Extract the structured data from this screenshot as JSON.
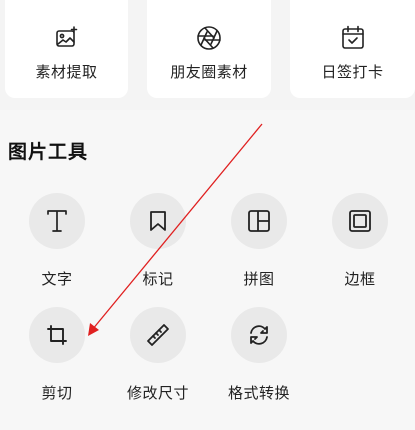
{
  "top_cards": [
    {
      "label": "素材提取",
      "icon": "image-extract-icon"
    },
    {
      "label": "朋友圈素材",
      "icon": "aperture-icon"
    },
    {
      "label": "日签打卡",
      "icon": "calendar-check-icon"
    }
  ],
  "section": {
    "title": "图片工具"
  },
  "tools": [
    {
      "label": "文字",
      "icon": "text-icon"
    },
    {
      "label": "标记",
      "icon": "bookmark-icon"
    },
    {
      "label": "拼图",
      "icon": "collage-layout-icon"
    },
    {
      "label": "边框",
      "icon": "frame-icon"
    },
    {
      "label": "剪切",
      "icon": "crop-icon"
    },
    {
      "label": "修改尺寸",
      "icon": "ruler-icon"
    },
    {
      "label": "格式转换",
      "icon": "format-convert-icon"
    }
  ],
  "colors": {
    "annotation_arrow": "#e02020",
    "card_background": "#ffffff",
    "tool_circle": "#e9e9e9"
  }
}
